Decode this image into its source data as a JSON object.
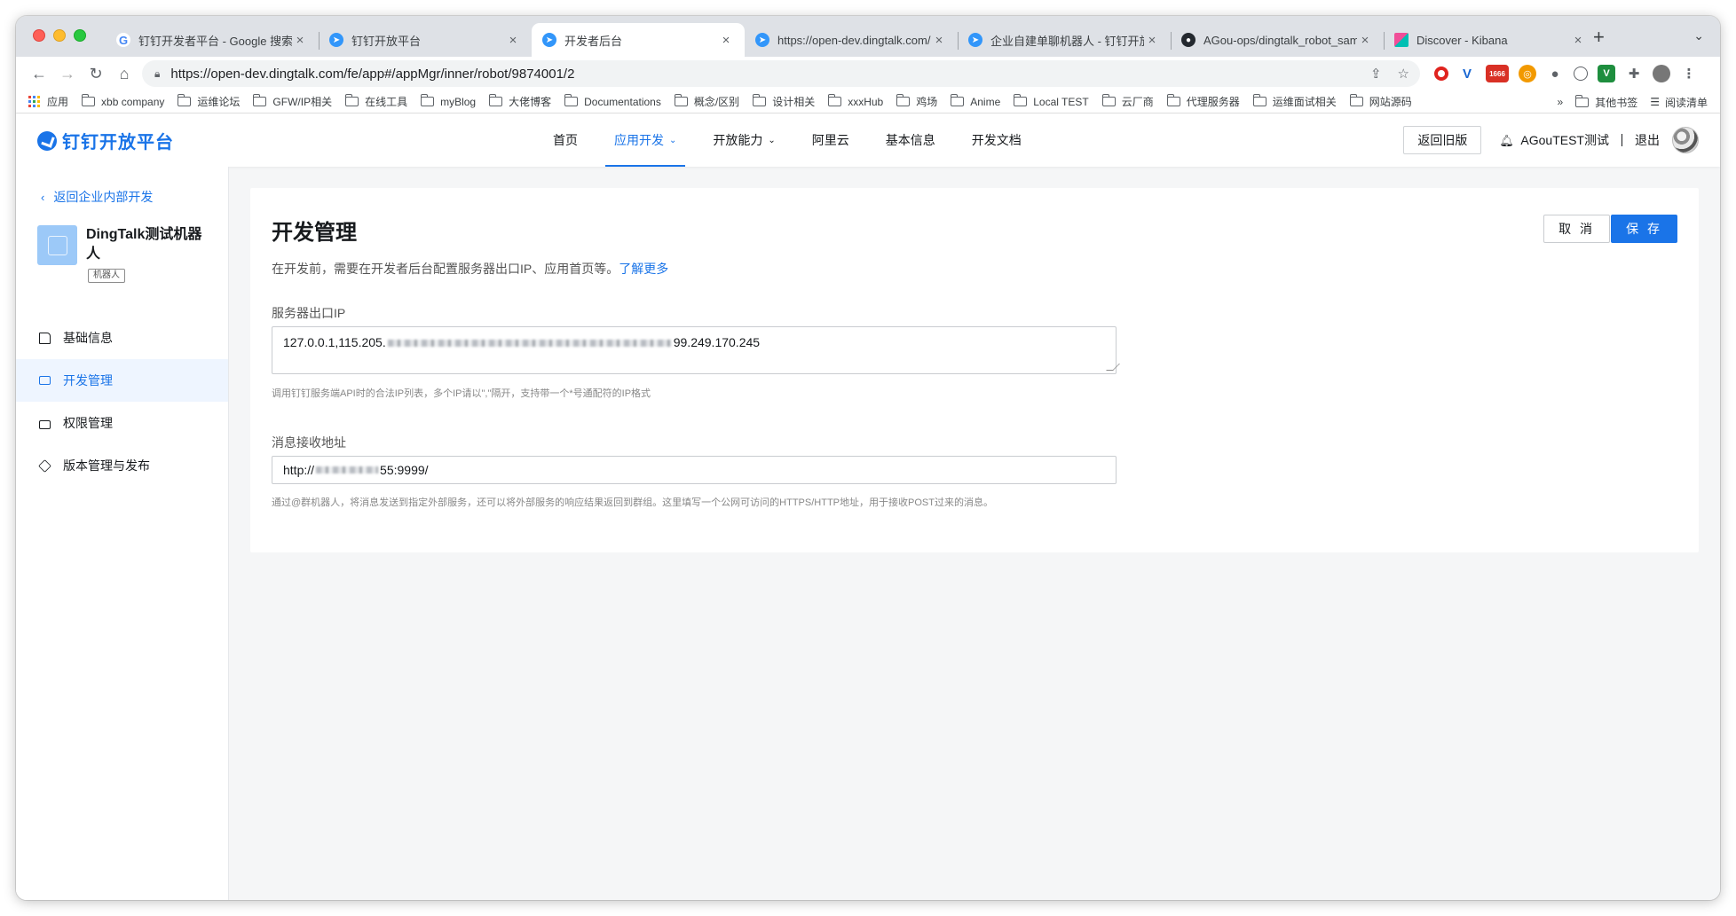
{
  "browser": {
    "tabs": [
      {
        "title": "钉钉开发者平台 - Google 搜索",
        "icon": "google-icon"
      },
      {
        "title": "钉钉开放平台",
        "icon": "dingtalk-icon"
      },
      {
        "title": "开发者后台",
        "icon": "dingtalk-icon",
        "active": true
      },
      {
        "title": "https://open-dev.dingtalk.com/",
        "icon": "dingtalk-icon"
      },
      {
        "title": "企业自建单聊机器人 - 钉钉开放",
        "icon": "dingtalk-icon"
      },
      {
        "title": "AGou-ops/dingtalk_robot_sam",
        "icon": "github-icon"
      },
      {
        "title": "Discover - Kibana",
        "icon": "kibana-icon"
      }
    ],
    "url": "https://open-dev.dingtalk.com/fe/app#/appMgr/inner/robot/9874001/2",
    "ext_badge": "1666",
    "bookmarks": [
      "应用",
      "xbb company",
      "运维论坛",
      "GFW/IP相关",
      "在线工具",
      "myBlog",
      "大佬博客",
      "Documentations",
      "概念/区别",
      "设计相关",
      "xxxHub",
      "鸡场",
      "Anime",
      "Local TEST",
      "云厂商",
      "代理服务器",
      "运维面试相关",
      "网站源码"
    ],
    "bookmarks_more": "»",
    "bookmarks_other": "其他书签",
    "reading_list": "阅读清单"
  },
  "header": {
    "logo_text": "钉钉开放平台",
    "menu": [
      {
        "label": "首页"
      },
      {
        "label": "应用开发",
        "active": true,
        "dropdown": true
      },
      {
        "label": "开放能力",
        "dropdown": true
      },
      {
        "label": "阿里云"
      },
      {
        "label": "基本信息"
      },
      {
        "label": "开发文档"
      }
    ],
    "old_version": "返回旧版",
    "user": "AGouTEST测试",
    "logout": "退出"
  },
  "sidebar": {
    "back": "返回企业内部开发",
    "app_name": "DingTalk测试机器人",
    "app_tag": "机器人",
    "items": [
      {
        "label": "基础信息",
        "icon": "document-icon"
      },
      {
        "label": "开发管理",
        "icon": "monitor-icon",
        "active": true
      },
      {
        "label": "权限管理",
        "icon": "lock-icon"
      },
      {
        "label": "版本管理与发布",
        "icon": "layers-icon"
      }
    ]
  },
  "main": {
    "title": "开发管理",
    "cancel": "取 消",
    "save": "保 存",
    "intro": "在开发前，需要在开发者后台配置服务器出口IP、应用首页等。",
    "learn_more": "了解更多",
    "ip_label": "服务器出口IP",
    "ip_value_prefix": "127.0.0.1,115.205.",
    "ip_value_suffix": "99.249.170.245",
    "ip_hint": "调用钉钉服务端API时的合法IP列表，多个IP请以\",\"隔开，支持带一个*号通配符的IP格式",
    "url_label": "消息接收地址",
    "url_value_prefix": "http://",
    "url_value_suffix": "55:9999/",
    "url_hint": "通过@群机器人，将消息发送到指定外部服务，还可以将外部服务的响应结果返回到群组。这里填写一个公网可访问的HTTPS/HTTP地址，用于接收POST过来的消息。"
  },
  "colors": {
    "accent": "#1a74e8",
    "active_bg": "#eef5ff"
  }
}
